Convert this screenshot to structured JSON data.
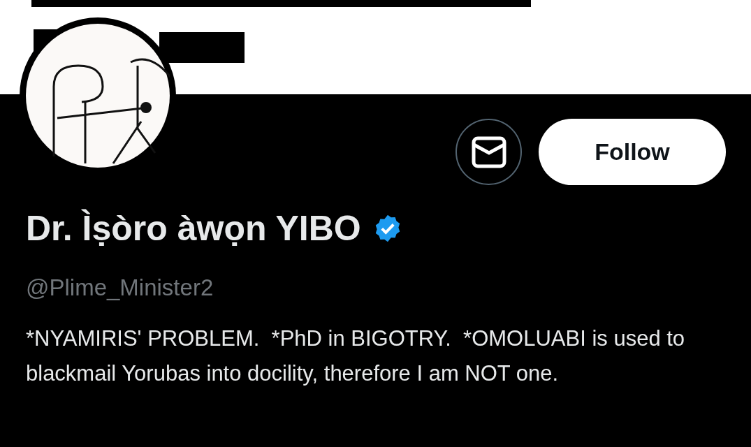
{
  "profile": {
    "name": "Dr. Ìṣòro àwọn YIBO",
    "verified": true,
    "handle": "@Plime_Minister2",
    "bio": "*NYAMIRIS' PROBLEM.  *PhD in BIGOTRY.  *OMOLUABI is used to blackmail Yorubas into docility, therefore I am NOT one."
  },
  "actions": {
    "follow_button": "Follow"
  }
}
